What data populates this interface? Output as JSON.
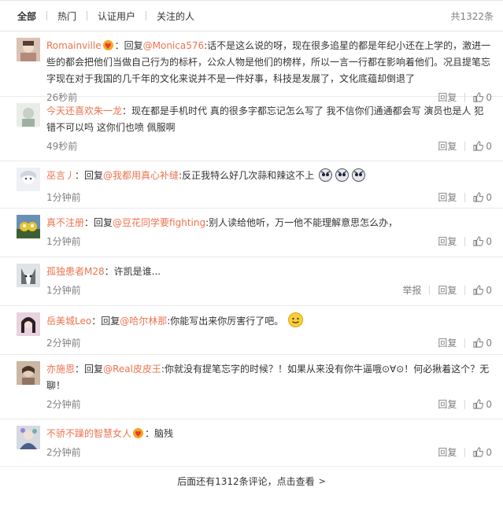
{
  "tabs": [
    {
      "label": "全部",
      "active": true
    },
    {
      "label": "热门",
      "active": false
    },
    {
      "label": "认证用户",
      "active": false
    },
    {
      "label": "关注的人",
      "active": false
    }
  ],
  "total": "共1322条",
  "labels": {
    "reply": "回复",
    "report": "举报",
    "reply_prefix": "回复",
    "colon": "："
  },
  "comments": [
    {
      "user": "Romainville",
      "crown": true,
      "reply_to": "@Monica576",
      "text": ":话不是这么说的呀，现在很多追星的都是年纪小还在上学的，激进一些的都会把他们当做自己行为的标杆，公众人物是他们的榜样，所以一言一行都在影响着他们。况且提笔忘字现在对于我国的几千年的文化来说并不是一件好事，科技是发展了，文化底蕴却倒退了",
      "time": "26秒前",
      "likes": "0"
    },
    {
      "user": "今天还喜欢朱一龙",
      "crown": false,
      "reply_to": "",
      "text": "现在都是手机时代 真的很多字都忘记怎么写了 我不信你们通通都会写 演员也是人 犯错不可以吗 这你们也喷 佩服啊",
      "time": "49秒前",
      "likes": "0"
    },
    {
      "user": "巫言丿",
      "crown": false,
      "reply_to": "@我都用真心补缝",
      "text": ":反正我特么好几次蒜和辣这不上",
      "time": "1分钟前",
      "likes": "0"
    },
    {
      "user": "真不注册",
      "crown": false,
      "reply_to": "@豆花同学要fighting",
      "text": ":别人读给他听，万一他不能理解意思怎么办，",
      "time": "1分钟前",
      "likes": "0"
    },
    {
      "user": "孤独患者M28",
      "crown": false,
      "reply_to": "",
      "text": "许凯是谁...",
      "time": "1分钟前",
      "likes": "0"
    },
    {
      "user": "岳美城Leo",
      "crown": false,
      "reply_to": "@哈尔林那",
      "text": ":你能写出来你厉害行了吧。",
      "time": "2分钟前",
      "likes": "0"
    },
    {
      "user": "亦施恩",
      "crown": false,
      "reply_to": "@Real皮皮王",
      "text": ":你就没有提笔忘字的时候？！如果从来没有你牛逼哦⊙∀⊙！何必揪着这个？无聊！",
      "time": "2分钟前",
      "likes": "0"
    },
    {
      "user": "不骄不躁的智慧女人",
      "crown": true,
      "reply_to": "",
      "text": "脑残",
      "time": "2分钟前",
      "likes": "0"
    }
  ],
  "more_text": "后面还有1312条评论，点击查看",
  "colors": {
    "accent": "#eb7350",
    "muted": "#808080",
    "text": "#333333"
  }
}
